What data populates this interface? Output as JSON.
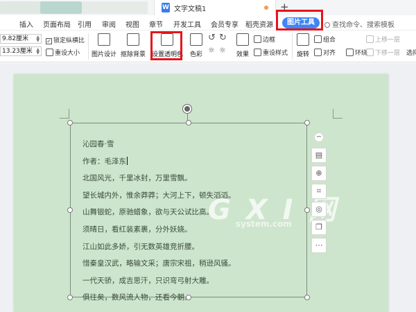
{
  "window": {
    "doc_tab_title": "文字文稿1",
    "new_tab": "+"
  },
  "menu": {
    "items": [
      "插入",
      "页面布局",
      "引用",
      "审阅",
      "视图",
      "章节",
      "开发工具",
      "会员专享",
      "稻壳资源"
    ],
    "active_tab": "图片工具",
    "search_placeholder": "查找命令、搜索模板"
  },
  "ribbon": {
    "height_value": "9.82厘米",
    "width_value": "13.23厘米",
    "lock_ratio": "锁定纵横比",
    "reset_size": "重设大小",
    "picture_design": "图片设计",
    "remove_background": "抠除背景",
    "set_transparent": "设置透明色",
    "color": "色彩",
    "effects": "效果",
    "border": "边框",
    "reset_style": "重设样式",
    "group": "组合",
    "align": "对齐",
    "rotate": "旋转",
    "wrap": "环绕",
    "bring_forward": "上移一层",
    "send_backward": "下移一层",
    "select": "选择"
  },
  "document": {
    "poem_lines": [
      "沁园春·雪",
      "作者：毛泽东",
      "北国风光，千里冰封，万里雪飘。",
      "望长城内外，惟余莽莽；大河上下，顿失滔滔。",
      "山舞银蛇，原驰蜡象，欲与天公试比高。",
      "须晴日，看红装素裹，分外妖娆。",
      "江山如此多娇，引无数英雄竞折腰。",
      "惜秦皇汉武，略输文采；唐宗宋祖，稍逊风骚。",
      "一代天骄，成吉思汗，只识弯弓射大雕。",
      "俱往矣，数风流人物，还看今朝。"
    ],
    "watermark": "G X I 网",
    "watermark_sub": "system.com"
  },
  "side_tools": [
    "minus-icon",
    "layout-icon",
    "zoom-icon",
    "crop-icon",
    "light-icon",
    "copy-icon",
    "more-icon"
  ],
  "colors": {
    "accent": "#3f85f5",
    "highlight_box": "#e5141b",
    "page_bg": "#cde5cc"
  }
}
